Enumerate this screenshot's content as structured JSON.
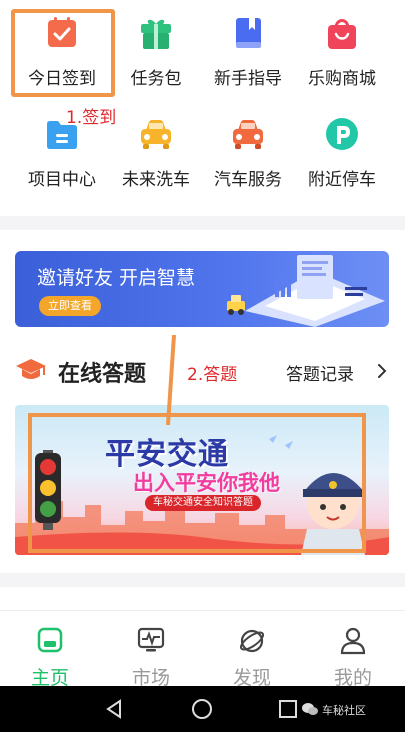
{
  "grid": {
    "items": [
      {
        "label": "今日签到",
        "icon": "calendar-check-icon",
        "color": "#f36b4a"
      },
      {
        "label": "任务包",
        "icon": "gift-icon",
        "color": "#2ec27e"
      },
      {
        "label": "新手指导",
        "icon": "bookmark-book-icon",
        "color": "#4a6cf0"
      },
      {
        "label": "乐购商城",
        "icon": "shopping-bag-icon",
        "color": "#f0445a"
      },
      {
        "label": "项目中心",
        "icon": "folder-icon",
        "color": "#3aa0f0"
      },
      {
        "label": "未来洗车",
        "icon": "car-wash-icon",
        "color": "#f7b42b"
      },
      {
        "label": "汽车服务",
        "icon": "car-service-icon",
        "color": "#f06a3e"
      },
      {
        "label": "附近停车",
        "icon": "parking-icon",
        "color": "#22c7a8"
      }
    ]
  },
  "annotations": {
    "step1": "1.签到",
    "step2": "2.答题"
  },
  "banner": {
    "title": "邀请好友  开启智慧",
    "button": "立即查看"
  },
  "section": {
    "title": "在线答题",
    "record": "答题记录"
  },
  "quiz_banner": {
    "line1": "平安交通",
    "line2": "出入平安你我他",
    "line3": "车秘交通安全知识答题"
  },
  "bottom_nav": [
    {
      "label": "主页",
      "icon": "home-icon",
      "active": true
    },
    {
      "label": "市场",
      "icon": "market-chart-icon",
      "active": false
    },
    {
      "label": "发现",
      "icon": "planet-discover-icon",
      "active": false
    },
    {
      "label": "我的",
      "icon": "user-profile-icon",
      "active": false
    }
  ],
  "watermark": "车秘社区",
  "colors": {
    "accent_green": "#1fc06a",
    "highlight_orange": "#f0964a",
    "annotation_red": "#e0292b"
  }
}
